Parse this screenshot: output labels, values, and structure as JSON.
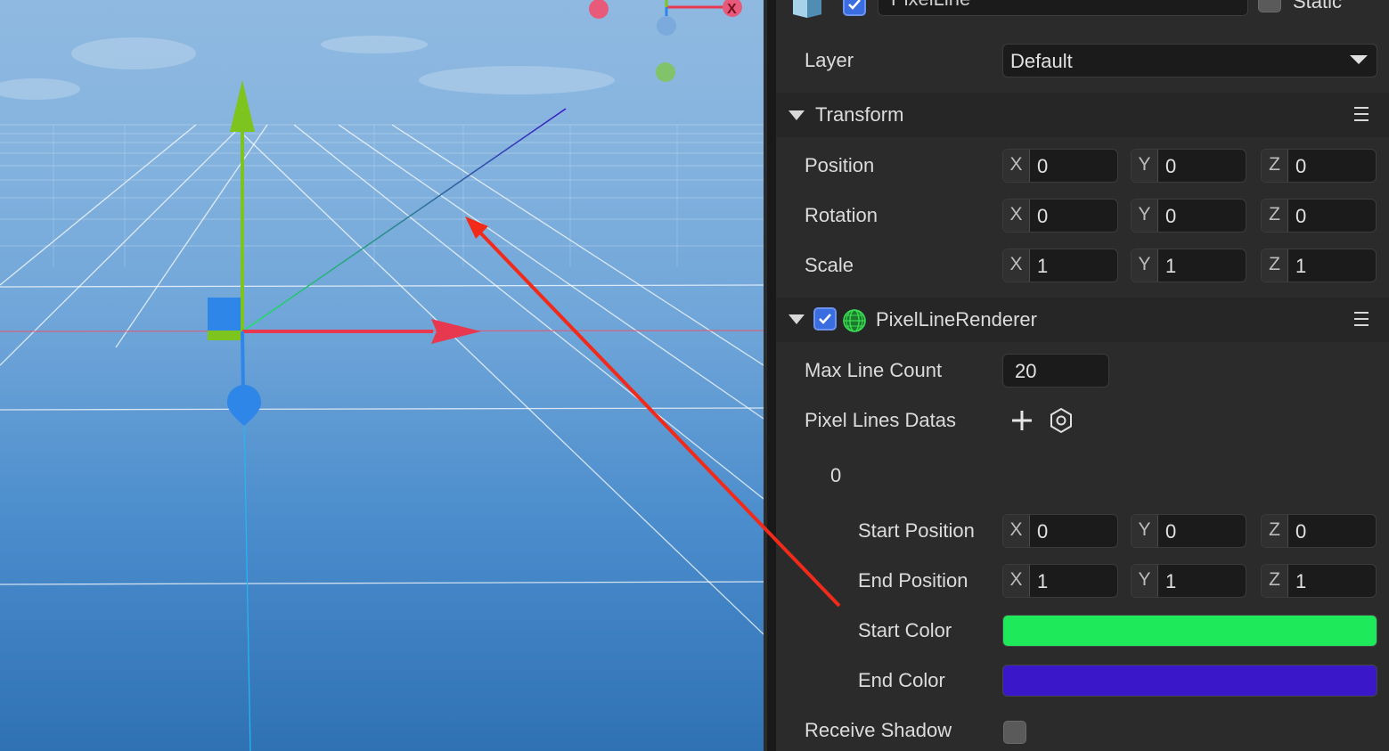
{
  "scene": {
    "gizmo_axis_label": "X"
  },
  "inspector": {
    "header": {
      "name_value": "PixelLine",
      "static_label": "Static"
    },
    "layer": {
      "label": "Layer",
      "value": "Default"
    },
    "transform": {
      "title": "Transform",
      "position": {
        "label": "Position",
        "x": "0",
        "y": "0",
        "z": "0"
      },
      "rotation": {
        "label": "Rotation",
        "x": "0",
        "y": "0",
        "z": "0"
      },
      "scale": {
        "label": "Scale",
        "x": "1",
        "y": "1",
        "z": "1"
      },
      "axis_x": "X",
      "axis_y": "Y",
      "axis_z": "Z"
    },
    "renderer": {
      "title": "PixelLineRenderer",
      "max_line_count": {
        "label": "Max Line Count",
        "value": "20"
      },
      "pixel_lines_datas": {
        "label": "Pixel Lines Datas"
      },
      "item_index": "0",
      "start_position": {
        "label": "Start Position",
        "x": "0",
        "y": "0",
        "z": "0"
      },
      "end_position": {
        "label": "End Position",
        "x": "1",
        "y": "1",
        "z": "1"
      },
      "start_color": {
        "label": "Start Color",
        "color": "#1de95a"
      },
      "end_color": {
        "label": "End Color",
        "color": "#3a17c8"
      },
      "receive_shadow": {
        "label": "Receive Shadow",
        "checked": false
      }
    }
  },
  "colors": {
    "accent_checkbox": "#3a6ee0",
    "gizmo_x": "#e8384f",
    "gizmo_y": "#7ec41e",
    "gizmo_z": "#2e86e8",
    "annotation_arrow": "#f22a1a"
  }
}
